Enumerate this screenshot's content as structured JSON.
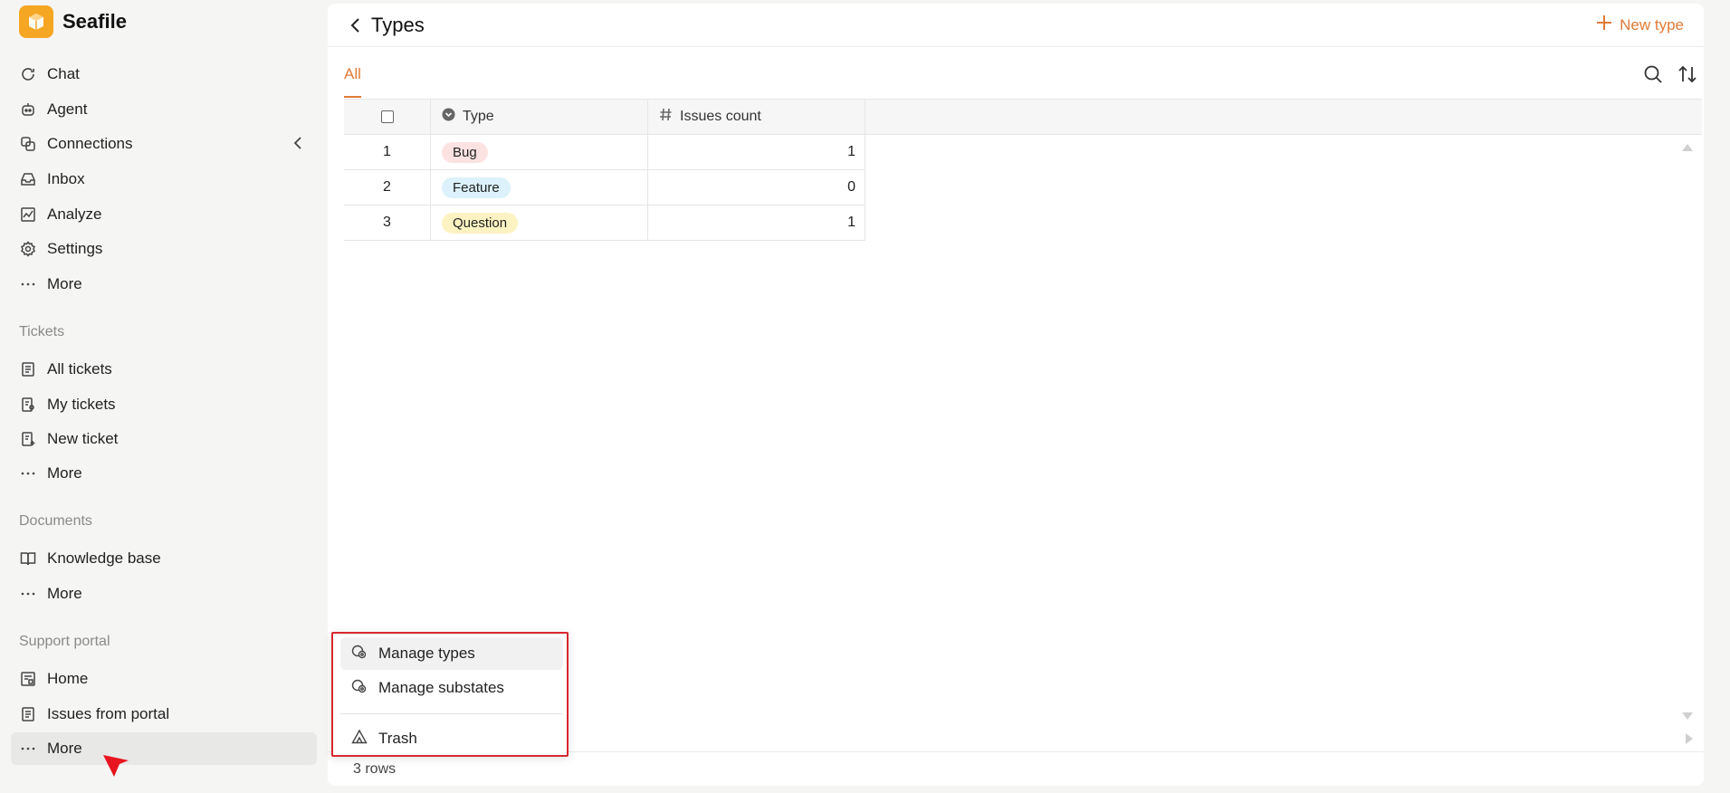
{
  "app": {
    "name": "Seafile"
  },
  "sidebar": {
    "items": [
      {
        "label": "Chat",
        "icon": "chat-icon"
      },
      {
        "label": "Agent",
        "icon": "agent-icon"
      },
      {
        "label": "Connections",
        "icon": "connections-icon"
      },
      {
        "label": "Inbox",
        "icon": "inbox-icon"
      },
      {
        "label": "Analyze",
        "icon": "analyze-icon"
      },
      {
        "label": "Settings",
        "icon": "gear-icon"
      },
      {
        "label": "More",
        "icon": "more-icon"
      }
    ],
    "tickets": {
      "title": "Tickets",
      "items": [
        {
          "label": "All tickets",
          "icon": "tickets-icon"
        },
        {
          "label": "My tickets",
          "icon": "my-tickets-icon"
        },
        {
          "label": "New ticket",
          "icon": "new-ticket-icon"
        },
        {
          "label": "More",
          "icon": "more-icon"
        }
      ]
    },
    "documents": {
      "title": "Documents",
      "items": [
        {
          "label": "Knowledge base",
          "icon": "book-icon"
        },
        {
          "label": "More",
          "icon": "more-icon"
        }
      ]
    },
    "portal": {
      "title": "Support portal",
      "items": [
        {
          "label": "Home",
          "icon": "home-icon"
        },
        {
          "label": "Issues from portal",
          "icon": "issues-icon"
        },
        {
          "label": "More",
          "icon": "more-icon"
        }
      ]
    }
  },
  "main": {
    "title": "Types",
    "new_button": "New type",
    "tabs": [
      {
        "label": "All"
      }
    ],
    "columns": {
      "type": "Type",
      "count": "Issues count"
    },
    "rows": [
      {
        "index": "1",
        "type": "Bug",
        "color": "#fde2e2",
        "count": "1"
      },
      {
        "index": "2",
        "type": "Feature",
        "color": "#dcf1fb",
        "count": "0"
      },
      {
        "index": "3",
        "type": "Question",
        "color": "#fdf3c2",
        "count": "1"
      }
    ],
    "footer": "3 rows"
  },
  "menu": {
    "items": [
      {
        "label": "Manage types",
        "icon": "manage-types-icon"
      },
      {
        "label": "Manage substates",
        "icon": "manage-substates-icon"
      },
      {
        "label": "Trash",
        "icon": "trash-icon"
      }
    ]
  },
  "colors": {
    "accent": "#e07a36",
    "logo": "#f5a623",
    "highlight": "#d6282e"
  }
}
